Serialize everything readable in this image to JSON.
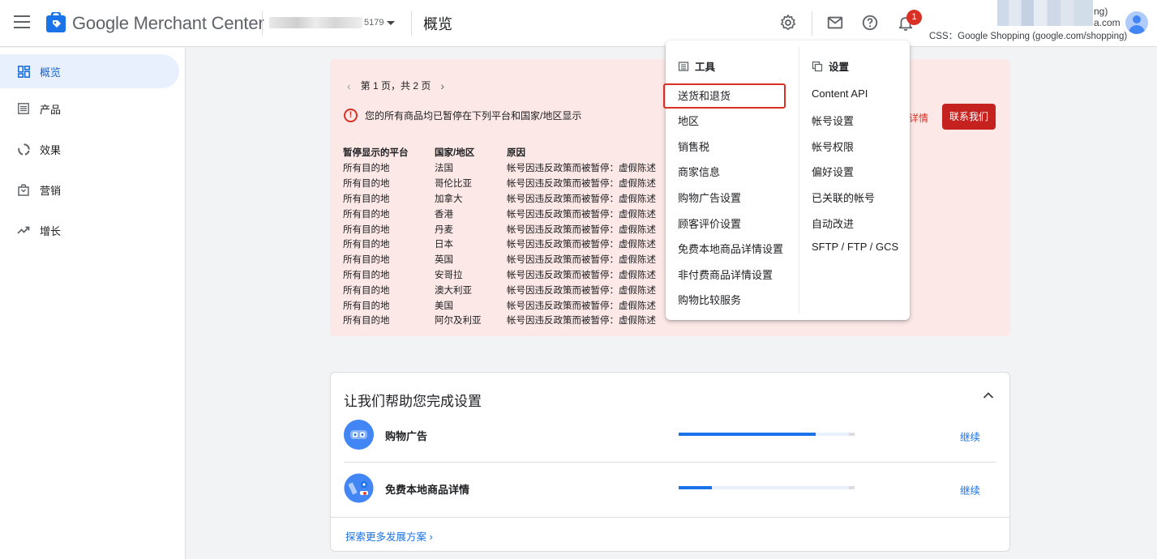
{
  "header": {
    "app_name": "Google Merchant Center",
    "account_id_suffix": "5179",
    "page_title": "概览",
    "notification_count": "1",
    "user_line1": "ng)",
    "user_line2": "a.com",
    "css_line": "CSS：Google Shopping (google.com/shopping)"
  },
  "sidebar": {
    "items": [
      {
        "label": "概览",
        "icon": "dashboard-icon",
        "active": true
      },
      {
        "label": "产品",
        "icon": "list-icon"
      },
      {
        "label": "效果",
        "icon": "donut-icon"
      },
      {
        "label": "营销",
        "icon": "bag-icon"
      },
      {
        "label": "增长",
        "icon": "trend-icon"
      }
    ]
  },
  "alert": {
    "pager": "第 1 页，共 2 页",
    "message": "您的所有商品均已暂停在下列平台和国家/地区显示",
    "details_link": "详情",
    "contact_button": "联系我们",
    "headers": [
      "暂停显示的平台",
      "国家/地区",
      "原因"
    ],
    "rows": [
      [
        "所有目的地",
        "法国",
        "帐号因违反政策而被暂停：虚假陈述"
      ],
      [
        "所有目的地",
        "哥伦比亚",
        "帐号因违反政策而被暂停：虚假陈述"
      ],
      [
        "所有目的地",
        "加拿大",
        "帐号因违反政策而被暂停：虚假陈述"
      ],
      [
        "所有目的地",
        "香港",
        "帐号因违反政策而被暂停：虚假陈述"
      ],
      [
        "所有目的地",
        "丹麦",
        "帐号因违反政策而被暂停：虚假陈述"
      ],
      [
        "所有目的地",
        "日本",
        "帐号因违反政策而被暂停：虚假陈述"
      ],
      [
        "所有目的地",
        "英国",
        "帐号因违反政策而被暂停：虚假陈述"
      ],
      [
        "所有目的地",
        "安哥拉",
        "帐号因违反政策而被暂停：虚假陈述"
      ],
      [
        "所有目的地",
        "澳大利亚",
        "帐号因违反政策而被暂停：虚假陈述"
      ],
      [
        "所有目的地",
        "美国",
        "帐号因违反政策而被暂停：虚假陈述"
      ],
      [
        "所有目的地",
        "阿尔及利亚",
        "帐号因违反政策而被暂停：虚假陈述"
      ]
    ]
  },
  "setup": {
    "title": "让我们帮助您完成设置",
    "rows": [
      {
        "label": "购物广告",
        "progress": 0.78,
        "action": "继续"
      },
      {
        "label": "免费本地商品详情",
        "progress": 0.19,
        "action": "继续"
      }
    ],
    "explore": "探索更多发展方案"
  },
  "menu": {
    "tools_title": "工具",
    "settings_title": "设置",
    "tools": [
      "送货和退货",
      "地区",
      "销售税",
      "商家信息",
      "购物广告设置",
      "顾客评价设置",
      "免费本地商品详情设置",
      "非付费商品详情设置",
      "购物比较服务"
    ],
    "settings": [
      "Content API",
      "帐号设置",
      "帐号权限",
      "偏好设置",
      "已关联的帐号",
      "自动改进",
      "SFTP / FTP / GCS"
    ],
    "highlighted_item": "送货和退货"
  },
  "colors": {
    "accent": "#1a73e8",
    "alert_bg": "#fce8e6",
    "error": "#d93025"
  }
}
